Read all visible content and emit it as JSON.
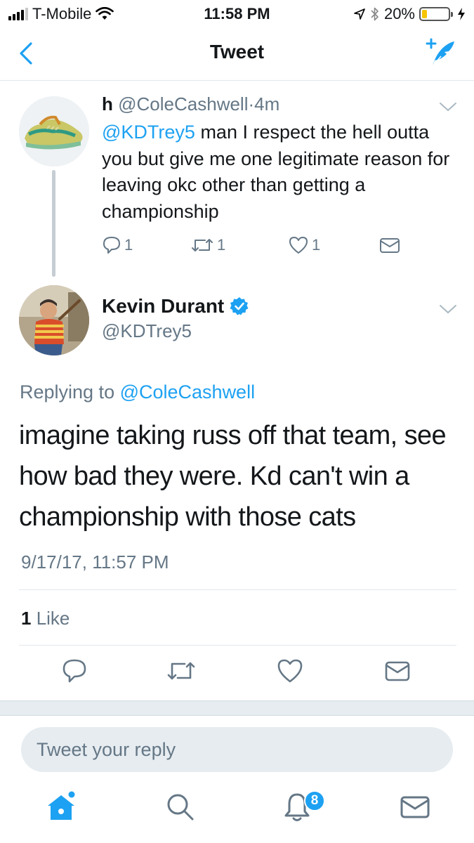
{
  "status_bar": {
    "carrier": "T-Mobile",
    "time": "11:58 PM",
    "battery_percent": "20%",
    "battery_level": 0.2,
    "icons": [
      "signal-icon",
      "wifi-icon",
      "location-icon",
      "bluetooth-icon",
      "battery-icon",
      "charging-icon"
    ]
  },
  "nav": {
    "title": "Tweet",
    "icons": [
      "back-icon",
      "compose-icon"
    ]
  },
  "parent_tweet": {
    "display_name": "h",
    "handle": "@ColeCashwell",
    "separator": "·",
    "age": "4m",
    "mention": "@KDTrey5",
    "text": " man I respect the hell outta you but give me one legitimate reason for leaving okc other than getting a championship",
    "reply_count": "1",
    "retweet_count": "1",
    "like_count": "1"
  },
  "main_tweet": {
    "display_name": "Kevin Durant",
    "handle": "@KDTrey5",
    "replying_prefix": "Replying to ",
    "replying_to": "@ColeCashwell",
    "text": "imagine taking russ off that team, see how bad they were. Kd can't win a championship with those cats",
    "timestamp": "9/17/17, 11:57 PM",
    "likes_count": "1",
    "likes_label": " Like"
  },
  "reply": {
    "placeholder": "Tweet your reply"
  },
  "tab_bar": {
    "tabs": [
      "home",
      "search",
      "notifications",
      "messages"
    ],
    "notification_badge": "8"
  },
  "colors": {
    "accent": "#1da1f2",
    "secondary_text": "#657786",
    "divider": "#e1e8ed",
    "battery": "#f6c500"
  }
}
